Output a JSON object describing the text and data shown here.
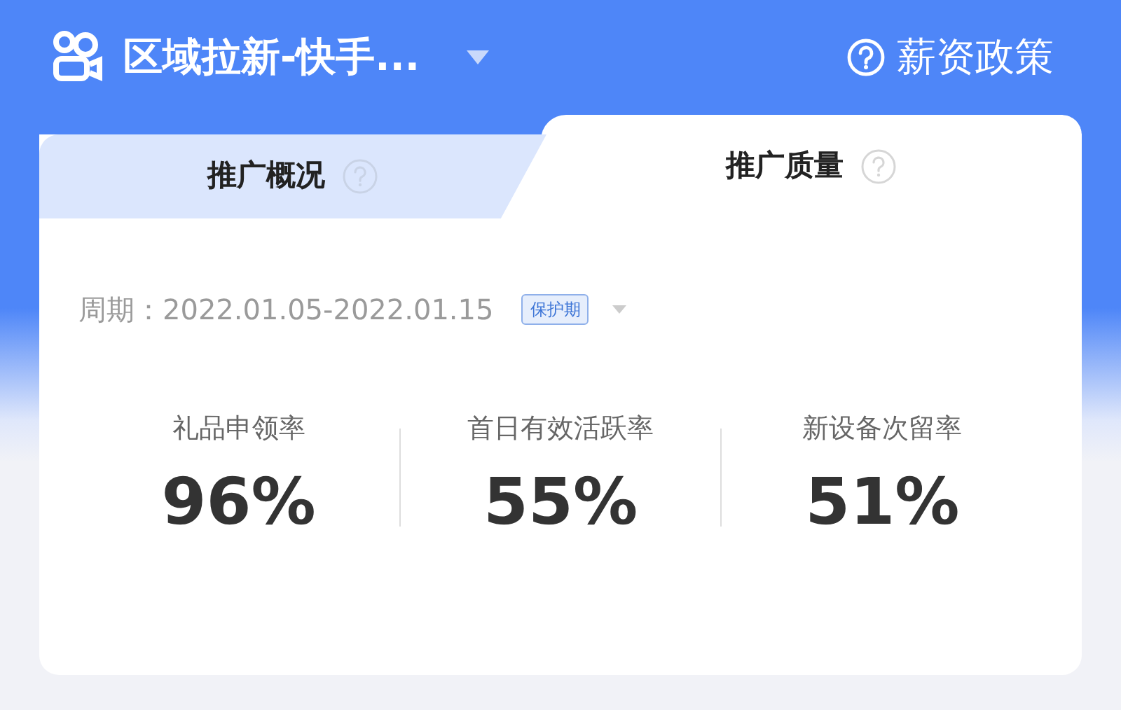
{
  "header": {
    "title": "区域拉新-快手...",
    "policy_link": "薪资政策"
  },
  "tabs": [
    {
      "label": "推广概况",
      "selected": false
    },
    {
      "label": "推广质量",
      "selected": true
    }
  ],
  "period": {
    "label": "周期：",
    "range": "2022.01.05-2022.01.15",
    "badge": "保护期"
  },
  "metrics": [
    {
      "label": "礼品申领率",
      "value": "96%"
    },
    {
      "label": "首日有效活跃率",
      "value": "55%"
    },
    {
      "label": "新设备次留率",
      "value": "51%"
    }
  ]
}
